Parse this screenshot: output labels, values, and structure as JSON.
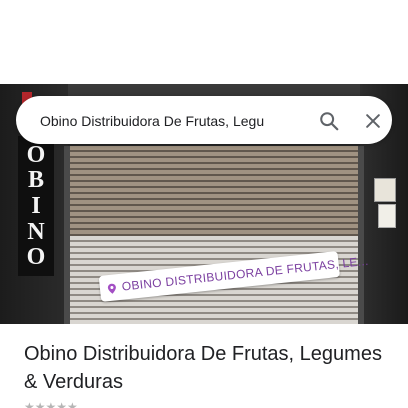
{
  "search": {
    "query": "Obino Distribuidora De Frutas, Legu",
    "search_icon": "search-icon",
    "close_icon": "close-icon"
  },
  "photo": {
    "sign_letters": [
      "O",
      "B",
      "I",
      "N",
      "O"
    ],
    "sticker_text": "OBINO DISTRIBUIDORA DE FRUTAS, LE...",
    "sticker_icon": "location-pin-icon",
    "sticker_color": "#7b3fa0"
  },
  "place": {
    "title": "Obino Distribuidora De Frutas, Legumes & Verduras"
  }
}
